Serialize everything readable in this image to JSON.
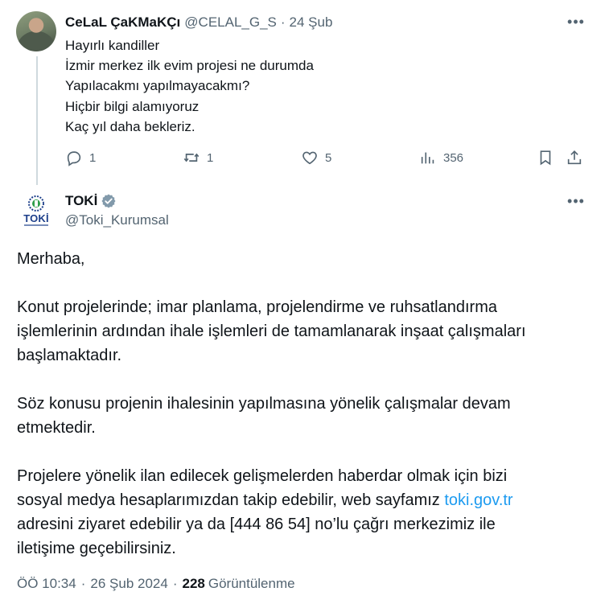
{
  "reply": {
    "name": "CeLaL ÇaKMaKÇı",
    "handle": "@CELAL_G_S",
    "separator": "·",
    "date": "24 Şub",
    "lines": [
      "Hayırlı kandiller",
      "İzmir merkez ilk evim projesi ne durumda",
      "Yapılacakmı yapılmayacakmı?",
      "Hiçbir bilgi alamıyoruz",
      "Kaç yıl daha bekleriz."
    ],
    "actions": {
      "replies": "1",
      "reposts": "1",
      "likes": "5",
      "views": "356"
    },
    "more_label": "•••"
  },
  "main": {
    "name": "TOKİ",
    "logo_text": "TOKİ",
    "handle": "@Toki_Kurumsal",
    "more_label": "•••",
    "para1": "Merhaba,",
    "para2_lines": [
      "Konut projelerinde; imar planlama, projelendirme ve ruhsatlandırma",
      "işlemlerinin ardından ihale işlemleri de tamamlanarak inşaat çalışmaları",
      "başlamaktadır."
    ],
    "para3_lines": [
      "Söz konusu projenin ihalesinin yapılmasına yönelik çalışmalar devam",
      "etmektedir."
    ],
    "para4_line1": "Projelere yönelik ilan edilecek gelişmelerden haberdar olmak için bizi",
    "para4_line2_pre": "sosyal medya hesaplarımızdan takip edebilir, web sayfamız ",
    "para4_link": "toki.gov.tr",
    "para4_line3": "adresini ziyaret edebilir ya da [444 86 54] no’lu çağrı merkezimiz ile",
    "para4_line4": "iletişime geçebilirsiniz.",
    "meta": {
      "time": "ÖÖ 10:34",
      "date": "26 Şub 2024",
      "separator": "·",
      "views": "228",
      "views_label": "Görüntülenme"
    }
  },
  "colors": {
    "text": "#0f1419",
    "muted": "#536471",
    "link": "#1d9bf0",
    "thread_line": "#cfd9de",
    "verified": "#829aab",
    "toki_blue": "#1d3f8a",
    "toki_green": "#2e9e4a"
  }
}
